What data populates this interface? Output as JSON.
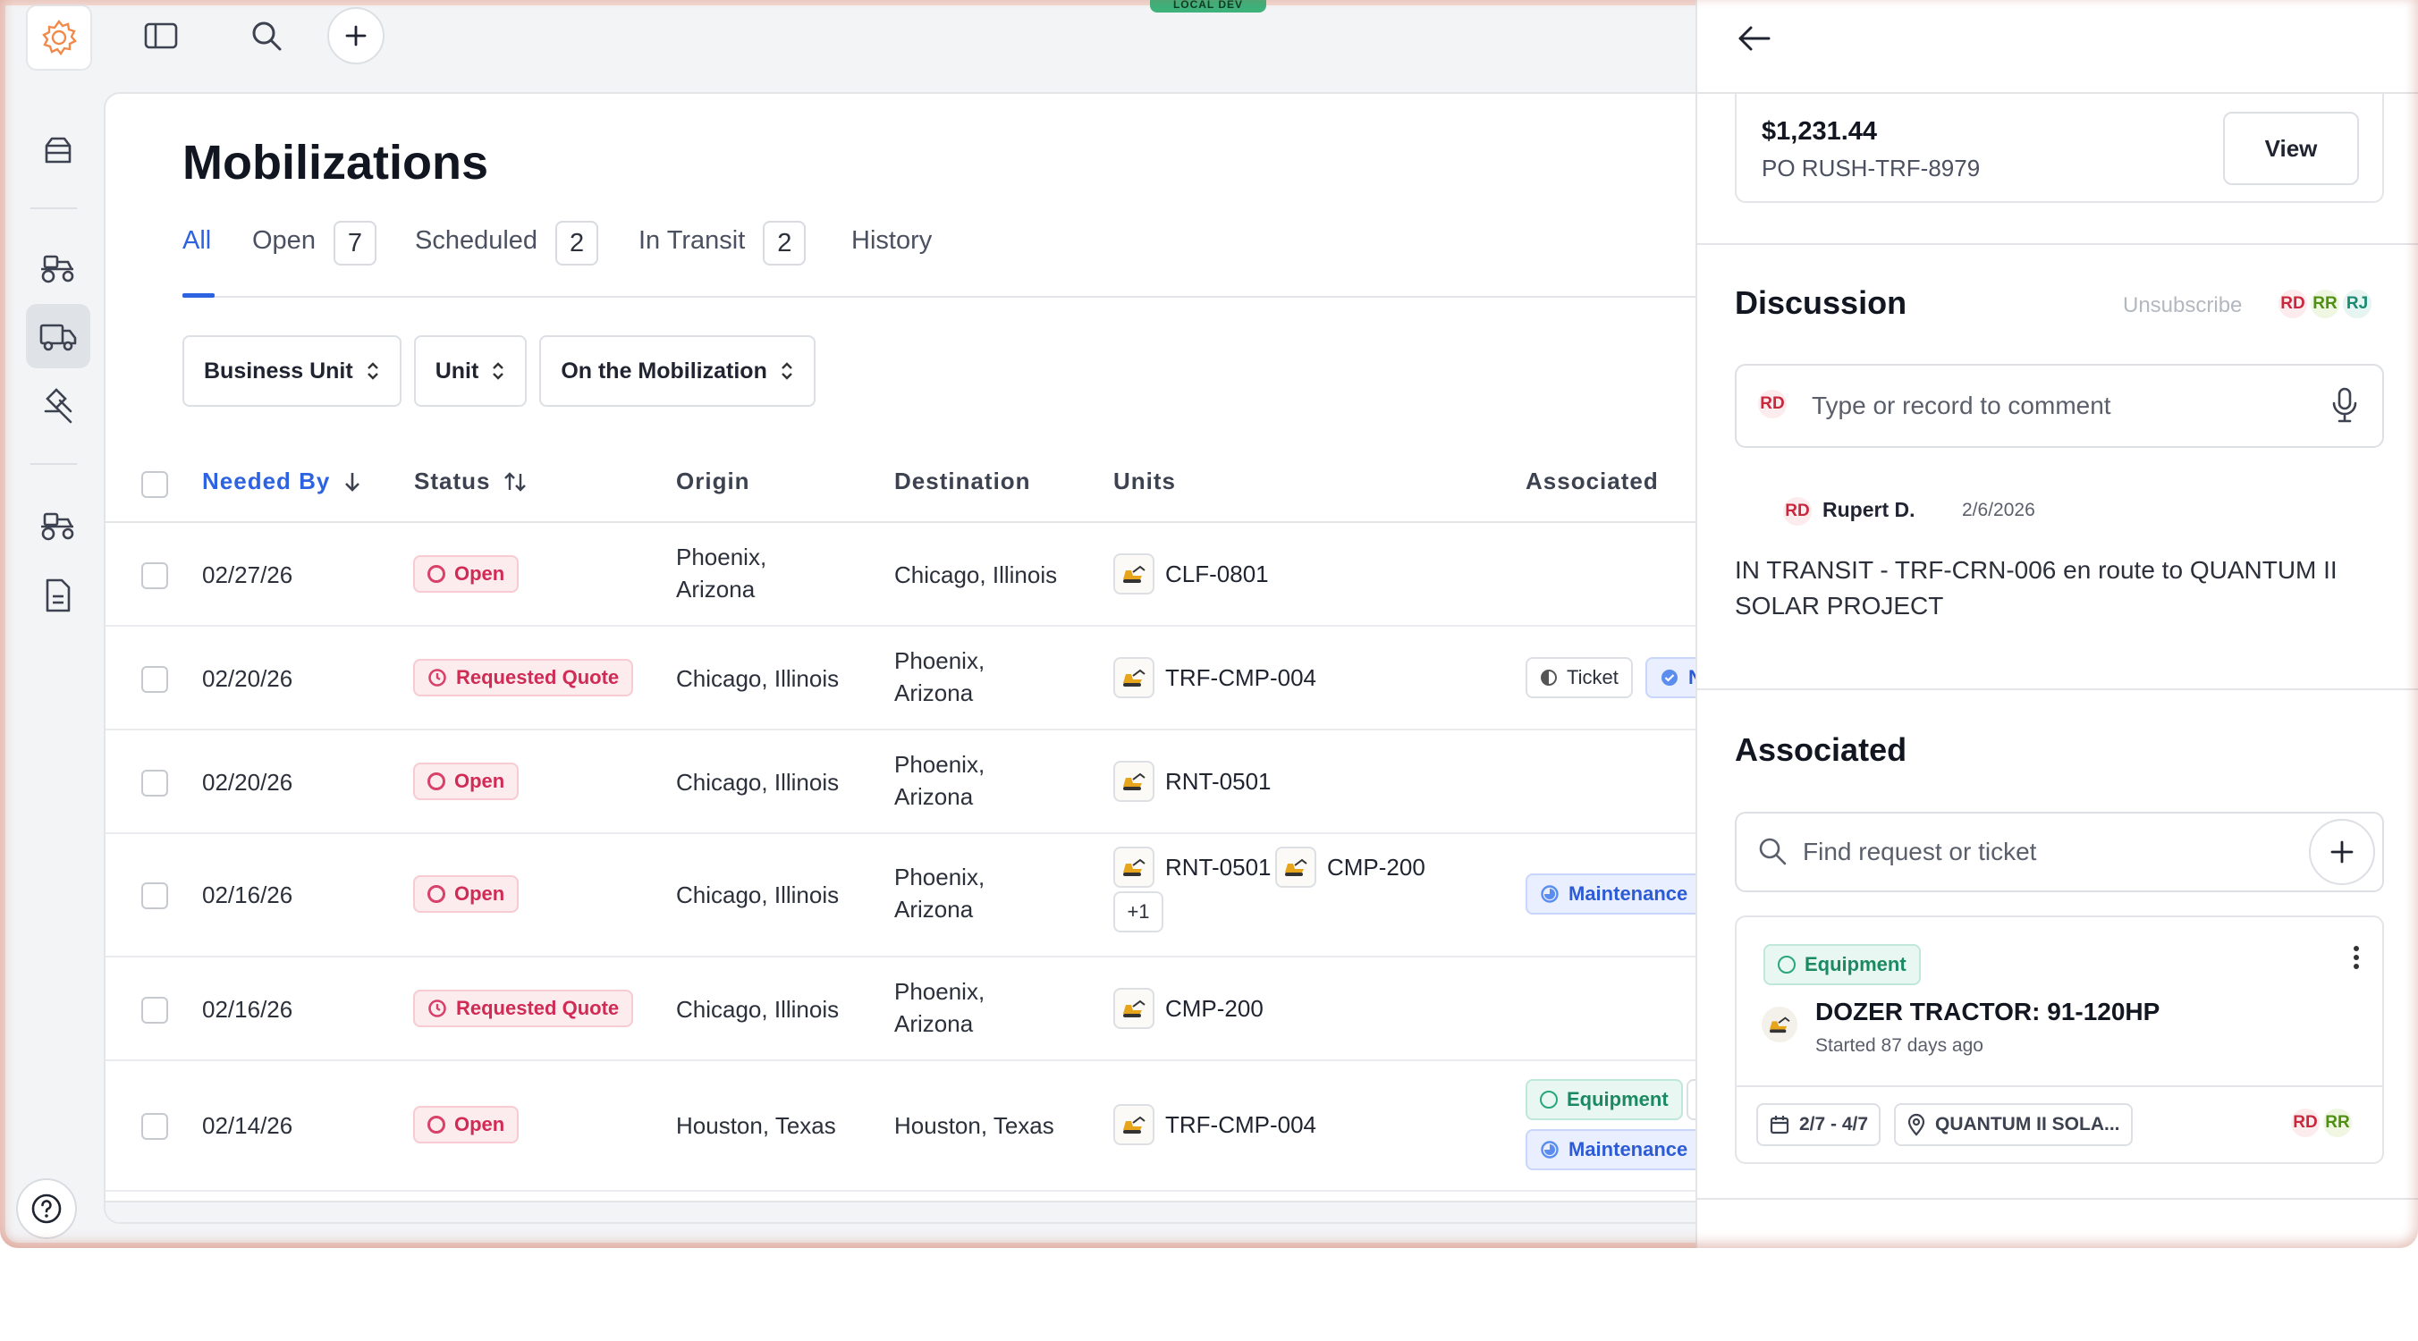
{
  "env_badge": "LOCAL DEV",
  "page": {
    "title": "Mobilizations"
  },
  "tabs": [
    {
      "label": "All",
      "count": null
    },
    {
      "label": "Open",
      "count": "7"
    },
    {
      "label": "Scheduled",
      "count": "2"
    },
    {
      "label": "In Transit",
      "count": "2"
    },
    {
      "label": "History",
      "count": null
    }
  ],
  "filters": [
    "Business Unit",
    "Unit",
    "On the Mobilization"
  ],
  "table": {
    "columns": [
      "Needed By",
      "Status",
      "Origin",
      "Destination",
      "Units",
      "Associated"
    ],
    "rows": [
      {
        "needed_by": "02/27/26",
        "status": "Open",
        "origin": [
          "Phoenix,",
          "Arizona"
        ],
        "destination": [
          "Chicago, Illinois"
        ],
        "units": [
          "CLF-0801"
        ]
      },
      {
        "needed_by": "02/20/26",
        "status": "Requested Quote",
        "origin": [
          "Chicago, Illinois"
        ],
        "destination": [
          "Phoenix,",
          "Arizona"
        ],
        "units": [
          "TRF-CMP-004"
        ],
        "associated": [
          "Ticket",
          "N"
        ]
      },
      {
        "needed_by": "02/20/26",
        "status": "Open",
        "origin": [
          "Chicago, Illinois"
        ],
        "destination": [
          "Phoenix,",
          "Arizona"
        ],
        "units": [
          "RNT-0501"
        ]
      },
      {
        "needed_by": "02/16/26",
        "status": "Open",
        "origin": [
          "Chicago, Illinois"
        ],
        "destination": [
          "Phoenix,",
          "Arizona"
        ],
        "units": [
          "RNT-0501",
          "CMP-200"
        ],
        "more": "+1",
        "associated": [
          "Maintenance"
        ]
      },
      {
        "needed_by": "02/16/26",
        "status": "Requested Quote",
        "origin": [
          "Chicago, Illinois"
        ],
        "destination": [
          "Phoenix,",
          "Arizona"
        ],
        "units": [
          "CMP-200"
        ]
      },
      {
        "needed_by": "02/14/26",
        "status": "Open",
        "origin": [
          "Houston, Texas"
        ],
        "destination": [
          "Houston, Texas"
        ],
        "units": [
          "TRF-CMP-004"
        ],
        "associated": [
          "Equipment",
          "Maintenance"
        ]
      }
    ]
  },
  "panel": {
    "po_amount": "$1,231.44",
    "po_number": "PO RUSH-TRF-8979",
    "view_label": "View",
    "discussion_title": "Discussion",
    "unsubscribe": "Unsubscribe",
    "watchers": [
      "RD",
      "RR",
      "RJ"
    ],
    "comment_avatar": "RD",
    "comment_placeholder": "Type or record to comment",
    "comment": {
      "avatar": "RD",
      "author": "Rupert D.",
      "date": "2/6/2026",
      "body": "IN TRANSIT - TRF-CRN-006 en route to QUANTUM II SOLAR PROJECT"
    },
    "associated_title": "Associated",
    "search_placeholder": "Find request or ticket",
    "card": {
      "chip": "Equipment",
      "title": "DOZER TRACTOR: 91-120HP",
      "subtitle": "Started 87 days ago",
      "dates": "2/7 - 4/7",
      "location": "QUANTUM II SOLA...",
      "assignees": [
        "RD",
        "RR"
      ]
    }
  },
  "colors": {
    "accent": "#2d63e0",
    "status_open": "#cf2b55",
    "equipment": "#1b8a63",
    "maintenance": "#2d5bd6",
    "window_border": "#f2d9d2"
  }
}
